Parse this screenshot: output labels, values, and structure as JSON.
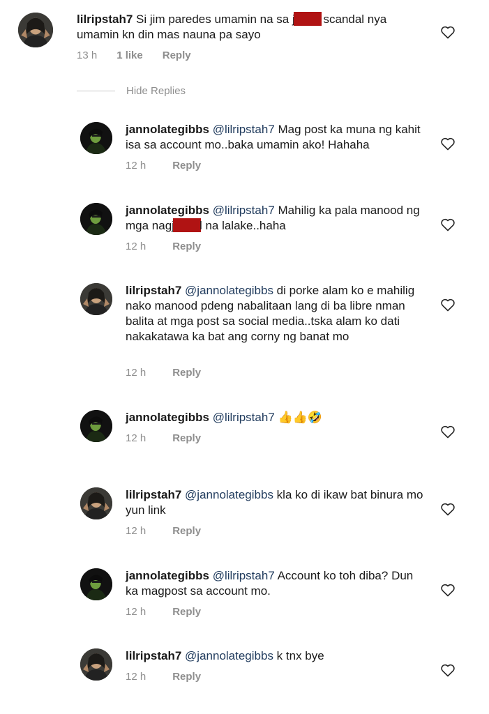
{
  "hide_replies_label": "Hide Replies",
  "reply_label": "Reply",
  "comments": [
    {
      "user": "lilripstah7",
      "text_a": "Si jim paredes umamin na sa j",
      "text_b": " scandal nya umamin kn din mas nauna pa sayo",
      "time": "13 h",
      "likes": "1 like"
    },
    {
      "user": "jannolategibbs",
      "mention": "@lilripstah7",
      "text": " Mag post ka muna ng kahit isa sa account mo..baka umamin ako! Hahaha",
      "time": "12 h"
    },
    {
      "user": "jannolategibbs",
      "mention": "@lilripstah7",
      "text_a": " Mahilig ka pala manood ng mga nagj",
      "text_b": "l na lalake..haha",
      "time": "12 h"
    },
    {
      "user": "lilripstah7",
      "mention": "@jannolategibbs",
      "text": " di porke alam ko e mahilig nako manood pdeng nabalitaan lang di ba libre nman balita at mga post sa social media..tska alam ko dati nakakatawa ka bat ang corny ng banat mo",
      "time": "12 h"
    },
    {
      "user": "jannolategibbs",
      "mention": "@lilripstah7",
      "text": " 👍👍🤣",
      "time": "12 h"
    },
    {
      "user": "lilripstah7",
      "mention": "@jannolategibbs",
      "text": " kla ko di ikaw bat binura mo yun link",
      "time": "12 h"
    },
    {
      "user": "jannolategibbs",
      "mention": "@lilripstah7",
      "text": " Account ko toh diba? Dun ka magpost sa account mo.",
      "time": "12 h"
    },
    {
      "user": "lilripstah7",
      "mention": "@jannolategibbs",
      "text": " k tnx bye",
      "time": "12 h"
    }
  ]
}
